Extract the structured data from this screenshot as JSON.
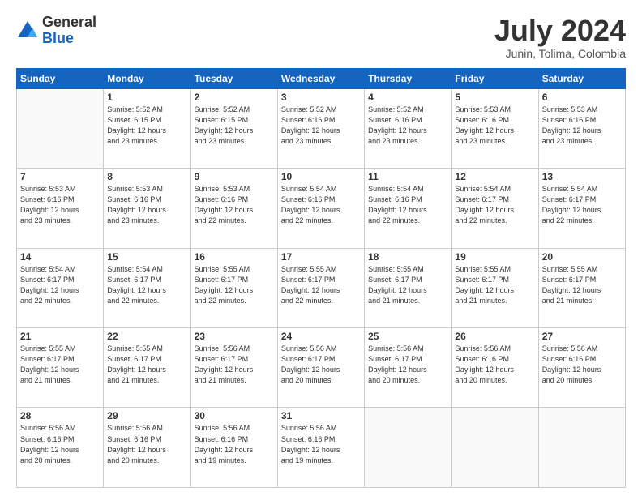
{
  "logo": {
    "general": "General",
    "blue": "Blue"
  },
  "header": {
    "month": "July 2024",
    "location": "Junin, Tolima, Colombia"
  },
  "days_of_week": [
    "Sunday",
    "Monday",
    "Tuesday",
    "Wednesday",
    "Thursday",
    "Friday",
    "Saturday"
  ],
  "weeks": [
    [
      {
        "day": "",
        "info": ""
      },
      {
        "day": "1",
        "info": "Sunrise: 5:52 AM\nSunset: 6:15 PM\nDaylight: 12 hours\nand 23 minutes."
      },
      {
        "day": "2",
        "info": "Sunrise: 5:52 AM\nSunset: 6:15 PM\nDaylight: 12 hours\nand 23 minutes."
      },
      {
        "day": "3",
        "info": "Sunrise: 5:52 AM\nSunset: 6:16 PM\nDaylight: 12 hours\nand 23 minutes."
      },
      {
        "day": "4",
        "info": "Sunrise: 5:52 AM\nSunset: 6:16 PM\nDaylight: 12 hours\nand 23 minutes."
      },
      {
        "day": "5",
        "info": "Sunrise: 5:53 AM\nSunset: 6:16 PM\nDaylight: 12 hours\nand 23 minutes."
      },
      {
        "day": "6",
        "info": "Sunrise: 5:53 AM\nSunset: 6:16 PM\nDaylight: 12 hours\nand 23 minutes."
      }
    ],
    [
      {
        "day": "7",
        "info": "Sunrise: 5:53 AM\nSunset: 6:16 PM\nDaylight: 12 hours\nand 23 minutes."
      },
      {
        "day": "8",
        "info": "Sunrise: 5:53 AM\nSunset: 6:16 PM\nDaylight: 12 hours\nand 23 minutes."
      },
      {
        "day": "9",
        "info": "Sunrise: 5:53 AM\nSunset: 6:16 PM\nDaylight: 12 hours\nand 22 minutes."
      },
      {
        "day": "10",
        "info": "Sunrise: 5:54 AM\nSunset: 6:16 PM\nDaylight: 12 hours\nand 22 minutes."
      },
      {
        "day": "11",
        "info": "Sunrise: 5:54 AM\nSunset: 6:16 PM\nDaylight: 12 hours\nand 22 minutes."
      },
      {
        "day": "12",
        "info": "Sunrise: 5:54 AM\nSunset: 6:17 PM\nDaylight: 12 hours\nand 22 minutes."
      },
      {
        "day": "13",
        "info": "Sunrise: 5:54 AM\nSunset: 6:17 PM\nDaylight: 12 hours\nand 22 minutes."
      }
    ],
    [
      {
        "day": "14",
        "info": "Sunrise: 5:54 AM\nSunset: 6:17 PM\nDaylight: 12 hours\nand 22 minutes."
      },
      {
        "day": "15",
        "info": "Sunrise: 5:54 AM\nSunset: 6:17 PM\nDaylight: 12 hours\nand 22 minutes."
      },
      {
        "day": "16",
        "info": "Sunrise: 5:55 AM\nSunset: 6:17 PM\nDaylight: 12 hours\nand 22 minutes."
      },
      {
        "day": "17",
        "info": "Sunrise: 5:55 AM\nSunset: 6:17 PM\nDaylight: 12 hours\nand 22 minutes."
      },
      {
        "day": "18",
        "info": "Sunrise: 5:55 AM\nSunset: 6:17 PM\nDaylight: 12 hours\nand 21 minutes."
      },
      {
        "day": "19",
        "info": "Sunrise: 5:55 AM\nSunset: 6:17 PM\nDaylight: 12 hours\nand 21 minutes."
      },
      {
        "day": "20",
        "info": "Sunrise: 5:55 AM\nSunset: 6:17 PM\nDaylight: 12 hours\nand 21 minutes."
      }
    ],
    [
      {
        "day": "21",
        "info": "Sunrise: 5:55 AM\nSunset: 6:17 PM\nDaylight: 12 hours\nand 21 minutes."
      },
      {
        "day": "22",
        "info": "Sunrise: 5:55 AM\nSunset: 6:17 PM\nDaylight: 12 hours\nand 21 minutes."
      },
      {
        "day": "23",
        "info": "Sunrise: 5:56 AM\nSunset: 6:17 PM\nDaylight: 12 hours\nand 21 minutes."
      },
      {
        "day": "24",
        "info": "Sunrise: 5:56 AM\nSunset: 6:17 PM\nDaylight: 12 hours\nand 20 minutes."
      },
      {
        "day": "25",
        "info": "Sunrise: 5:56 AM\nSunset: 6:17 PM\nDaylight: 12 hours\nand 20 minutes."
      },
      {
        "day": "26",
        "info": "Sunrise: 5:56 AM\nSunset: 6:16 PM\nDaylight: 12 hours\nand 20 minutes."
      },
      {
        "day": "27",
        "info": "Sunrise: 5:56 AM\nSunset: 6:16 PM\nDaylight: 12 hours\nand 20 minutes."
      }
    ],
    [
      {
        "day": "28",
        "info": "Sunrise: 5:56 AM\nSunset: 6:16 PM\nDaylight: 12 hours\nand 20 minutes."
      },
      {
        "day": "29",
        "info": "Sunrise: 5:56 AM\nSunset: 6:16 PM\nDaylight: 12 hours\nand 20 minutes."
      },
      {
        "day": "30",
        "info": "Sunrise: 5:56 AM\nSunset: 6:16 PM\nDaylight: 12 hours\nand 19 minutes."
      },
      {
        "day": "31",
        "info": "Sunrise: 5:56 AM\nSunset: 6:16 PM\nDaylight: 12 hours\nand 19 minutes."
      },
      {
        "day": "",
        "info": ""
      },
      {
        "day": "",
        "info": ""
      },
      {
        "day": "",
        "info": ""
      }
    ]
  ]
}
